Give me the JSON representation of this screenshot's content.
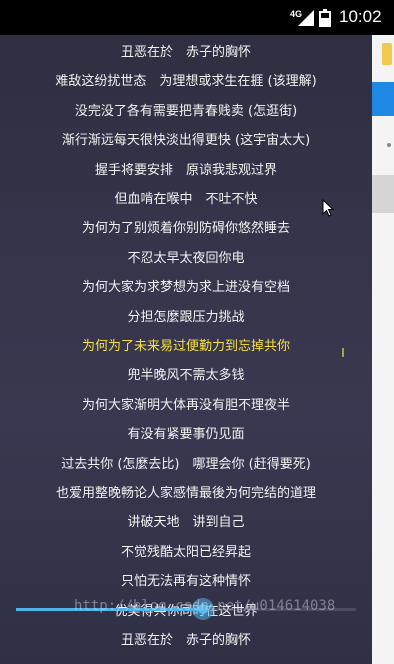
{
  "status_bar": {
    "network": "4G",
    "time": "10:02"
  },
  "lyrics": [
    "丑恶在於　赤子的胸怀",
    "难敌这纷扰世态　为理想或求生在捱 (该理解)",
    "没完没了各有需要把青春贱卖 (怎逛街)",
    "渐行渐远每天很快淡出得更快 (这宇宙太大)",
    "握手将要安排　原谅我悲观过界",
    "但血啃在喉中　不吐不快",
    "为何为了别烦着你别防碍你悠然睡去",
    "不忍太早太夜回你电",
    "为何大家为求梦想为求上进没有空档",
    "分担怎麼跟压力挑战",
    "为何为了未来易过便勤力到忘掉共你",
    "兜半晚风不需太多钱",
    "为何大家渐明大体再没有胆不理夜半",
    "有没有紧要事仍见面",
    "过去共你 (怎麼去比)　哪理会你 (赶得要死)",
    "也爱用整晚畅论人家感情最後为何完结的道理",
    "讲破天地　讲到自己",
    "不觉残酷太阳已经昇起",
    "只怕无法再有这种情怀",
    "优美得共你同时在这世界",
    "丑恶在於　赤子的胸怀"
  ],
  "active_lyric_index": 10,
  "playback": {
    "progress_fraction": 0.55
  },
  "watermark": "http://blog.csdn.net/u014614038",
  "colors": {
    "active_lyric": "#f7e23a",
    "lyric_text": "#f2f2f2",
    "progress": "#4fb3e8"
  }
}
